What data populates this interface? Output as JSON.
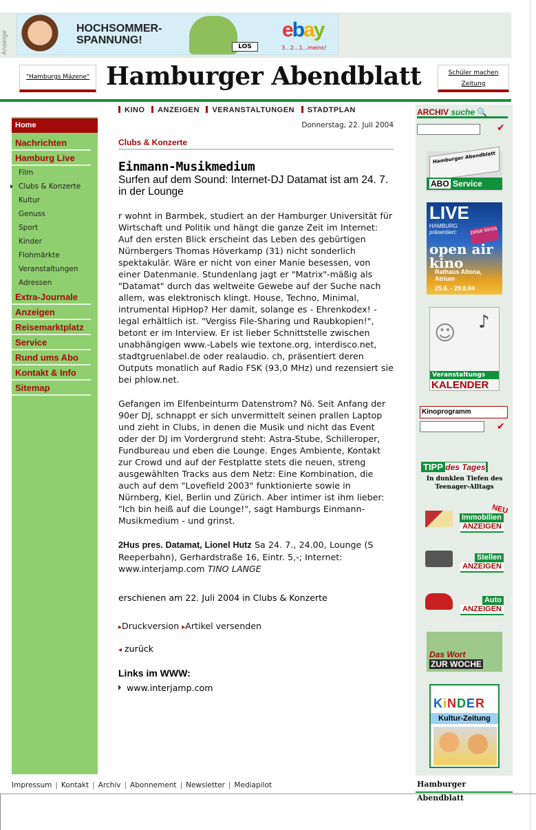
{
  "ad": {
    "label": "Anzeige",
    "banner_headline": "HOCHSOMMER-SPANNUNG!",
    "banner_button": "LOS",
    "banner_brand": [
      "e",
      "b",
      "a",
      "y"
    ],
    "banner_tagline": "3...2...1...meins!"
  },
  "masthead": {
    "left_link": "\"Hamburgs Mäzene\"",
    "logo_text": "Hamburger Abendblatt",
    "right_link": "Schüler machen Zeitung"
  },
  "leftnav": {
    "home": "Home",
    "nachrichten": "Nachrichten",
    "hamburg_live": "Hamburg Live",
    "subs": [
      "Film",
      "Clubs & Konzerte",
      "Kultur",
      "Genuss",
      "Sport",
      "Kinder",
      "Flohmärkte",
      "Veranstaltungen",
      "Adressen"
    ],
    "extra_journale": "Extra-Journale",
    "anzeigen": "Anzeigen",
    "reisemarktplatz": "Reisemarktplatz",
    "service": "Service",
    "rund_ums_abo": "Rund ums Abo",
    "kontakt_info": "Kontakt & Info",
    "sitemap": "Sitemap"
  },
  "topnav": [
    "KINO",
    "ANZEIGEN",
    "VERANSTALTUNGEN",
    "STADTPLAN"
  ],
  "article": {
    "date": "Donnerstag, 22. Juli 2004",
    "section": "Clubs & Konzerte",
    "title": "Einmann-Musikmedium",
    "subtitle": "Surfen auf dem Sound: Internet-DJ Datamat ist am 24. 7. in der Lounge",
    "para1": "r wohnt in Barmbek, studiert an der Hamburger Universität für Wirtschaft und Politik und hängt die ganze Zeit im Internet: Auf den ersten Blick erscheint das Leben des gebürtigen Nürnbergers Thomas Höverkamp (31) nicht sonderlich spektakulär. Wäre er nicht von einer Manie besessen, von einer Datenmanie. Stundenlang jagt er \"Matrix\"-mäßig als \"Datamat\" durch das weltweite Gewebe auf der Suche nach allem, was elektronisch klingt. House, Techno, Minimal, intrumental HipHop? Her damit, solange es - Ehrenkodex! - legal erhältlich ist. \"Vergiss File-Sharing und Raubkopien!\", betont er im Interview. Er ist lieber Schnittstelle zwischen unabhängigen www.-Labels wie textone.org, interdisco.net, stadtgruenlabel.de oder realaudio. ch, präsentiert deren Outputs monatlich auf Radio FSK (93,0 MHz) und rezensiert sie bei phlow.net.",
    "para2": "Gefangen im Elfenbeinturm Datenstrom? Nö. Seit Anfang der 90er DJ, schnappt er sich unvermittelt seinen prallen Laptop und zieht in Clubs, in denen die Musik und nicht das Event oder der DJ im Vordergrund steht: Astra-Stube, Schilleroper, Fundbureau und eben die Lounge. Enges Ambiente, Kontakt zur Crowd und auf der Festplatte stets die neuen, streng ausgewählten Tracks aus dem Netz: Eine Kombination, die auch auf dem \"Lovefield 2003\" funktionierte sowie in Nürnberg, Kiel, Berlin und Zürich. Aber intimer ist ihm lieber: \"Ich bin heiß auf die Lounge!\", sagt Hamburgs Einmann-Musikmedium - und grinst.",
    "info_bold": "2Hus pres. Datamat, Lionel Hutz",
    "info_text": " Sa 24. 7., 24.00, Lounge (S Reeperbahn), Gerhardstraße 16, Eintr. 5,-; Internet: www.interjamp.com ",
    "author": "TINO LANGE",
    "published": "erschienen am 22. Juli 2004 in Clubs & Konzerte",
    "print_link": "Druckversion",
    "send_link": "Artikel versenden",
    "back_link": "zurück",
    "links_heading": "Links im WWW:",
    "link1": "www.interjamp.com"
  },
  "rightcol": {
    "archiv_title": "ARCHIV",
    "archiv_suche": "suche",
    "abo_label": "ABO",
    "abo_service": "Service",
    "abo_paper": "Hamburger Abendblatt",
    "live_title": "LIVE",
    "live_sub": "HAMBURG präsentiert:",
    "live_zeise": "zeise kinos",
    "live_openair": "open air kino",
    "live_place": "Rathaus Altona, Atrium",
    "live_dates": "25.6. - 29.8.04",
    "kalender_label": "Veranstaltungs",
    "kalender_title": "KALENDER",
    "kino_label": "Kinoprogramm",
    "tipp_title": "TIPP",
    "tipp_suffix": "des Tages",
    "tipp_text": "In dunklen Tiefen des Teenager-Alltags",
    "immo_neu": "NEU",
    "immo_label": "Immobilien",
    "immo_anzeigen": "ANZEIGEN",
    "stellen_label": "Stellen",
    "stellen_anzeigen": "ANZEIGEN",
    "auto_label": "Auto",
    "auto_anzeigen": "ANZEIGEN",
    "wort_1": "Das Wort",
    "wort_2": "ZUR WOCHE",
    "kinder_letters": [
      "K",
      "i",
      "N",
      "D",
      "E",
      "R"
    ],
    "kinder_sub": "Kultur-Zeitung"
  },
  "footer": {
    "links": [
      "Impressum",
      "Kontakt",
      "Archiv",
      "Abonnement",
      "Newsletter",
      "Mediapilot"
    ],
    "logo": "Hamburger Abendblatt"
  }
}
